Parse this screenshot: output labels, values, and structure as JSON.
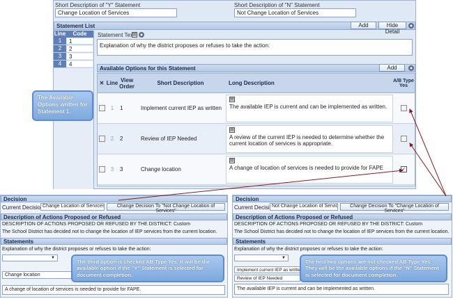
{
  "top": {
    "y_label": "Short Description of \"Y\" Statement",
    "y_value": "Change Location of Services",
    "n_label": "Short Description of \"N\" Statement",
    "n_value": "Not Change Location of Services"
  },
  "statement_list": {
    "title": "Statement List",
    "add": "Add",
    "hide_detail": "Hide Detail",
    "col_line": "Line",
    "col_code": "Code",
    "rows": [
      {
        "line": "1",
        "code": "1"
      },
      {
        "line": "2",
        "code": "2"
      },
      {
        "line": "3",
        "code": "3"
      },
      {
        "line": "4",
        "code": "4"
      }
    ],
    "text_label": "Statement Text",
    "text_value": "Explanation of why the district proposes or refuses to take the action:"
  },
  "options": {
    "title": "Available Options for this Statement",
    "add": "Add",
    "col_line": "Line",
    "col_view": "View Order",
    "col_short": "Short Description",
    "col_long": "Long Description",
    "col_ab": "A/B Type Yes",
    "rows": [
      {
        "line": "1",
        "order": "1",
        "short": "Implement current IEP as written",
        "long": "The available IEP is current and can be implemented as written.",
        "checked": false
      },
      {
        "line": "2",
        "order": "2",
        "short": "Review of IEP Needed",
        "long": "A review of the current IEP is needed to determine whether the current location of services is appropriate.",
        "checked": false
      },
      {
        "line": "3",
        "order": "3",
        "short": "Change location",
        "long": "A change of location of services is needed to provide for FAPE",
        "checked": true
      }
    ]
  },
  "callouts": {
    "c1": "The Available Options written for Statement 1.",
    "c2": "The third option is checked AB Type Yes. It will be the available option if the \"Y\" Statement is selected for document completion.",
    "c3": "The first two options are not checked AB Type Yes. They will be the available options if the \"N\" Statement is selected for document completion."
  },
  "left_doc": {
    "decision": "Decision",
    "current_label": "Current Decision:",
    "current_value": "Change Location of Services",
    "change_btn": "Change Decision To \"Not Change Location of Services\"",
    "desc_hdr": "Description of Actions Proposed or Refused",
    "desc_line1": "DESCRIPTION OF ACTIONS PROPOSED OR REFUSED BY THE DISTRICT: Custom",
    "desc_line2": "The School District has decided not to change the location of IEP services from the current location.",
    "statements": "Statements",
    "expl": "Explanation of why the district proposes or refuses to take the action:",
    "select_value": "Change location",
    "text": "A change of location of services is needed to provide for FAPE."
  },
  "right_doc": {
    "decision": "Decision",
    "current_label": "Current Decision:",
    "current_value": "Not Change Location of Services",
    "change_btn": "Change Decision To \"Change Location of Services\"",
    "desc_hdr": "Description of Actions Proposed or Refused",
    "desc_line1": "DESCRIPTION OF ACTIONS PROPOSED OR REFUSED BY THE DISTRICT: Custom",
    "desc_line2": "The School District has decided not to change the location of IEP services from the current location.",
    "statements": "Statements",
    "expl": "Explanation of why the district proposes or refuses to take the action:",
    "select_value": "Implement current IEP as written",
    "select_value2": "Review of IEP Needed",
    "text": "The available IEP is current and can be implemented as written."
  },
  "colors": {
    "accent": "#b4c8e6",
    "arrow": "#8b1a1a"
  }
}
